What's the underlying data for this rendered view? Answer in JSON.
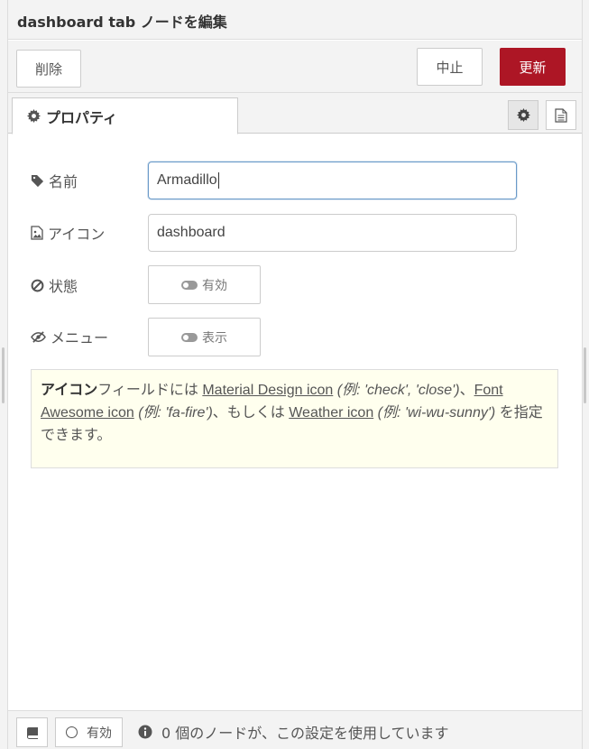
{
  "header": {
    "title": "dashboard tab ノードを編集"
  },
  "toolbar": {
    "delete_label": "削除",
    "cancel_label": "中止",
    "update_label": "更新"
  },
  "tabs": {
    "properties_label": "プロパティ"
  },
  "form": {
    "name_label": "名前",
    "name_value": "Armadillo",
    "icon_label": "アイコン",
    "icon_value": "dashboard",
    "state_label": "状態",
    "state_toggle": "有効",
    "menu_label": "メニュー",
    "menu_toggle": "表示"
  },
  "tip": {
    "bold": "アイコン",
    "t1": "フィールドには ",
    "link1": "Material Design icon",
    "ex1": " (例: 'check', 'close')",
    "t2": "、",
    "link2": "Font Awesome icon",
    "ex2": " (例: 'fa-fire')",
    "t3": "、もしくは ",
    "link3": "Weather icon",
    "ex3": " (例: 'wi-wu-sunny')",
    "t4": " を指定できます。"
  },
  "footer": {
    "enable_label": "有効",
    "usage_text": "0 個のノードが、この設定を使用しています"
  },
  "colors": {
    "update_button": "#ad1625",
    "tip_background": "#ffffee"
  }
}
